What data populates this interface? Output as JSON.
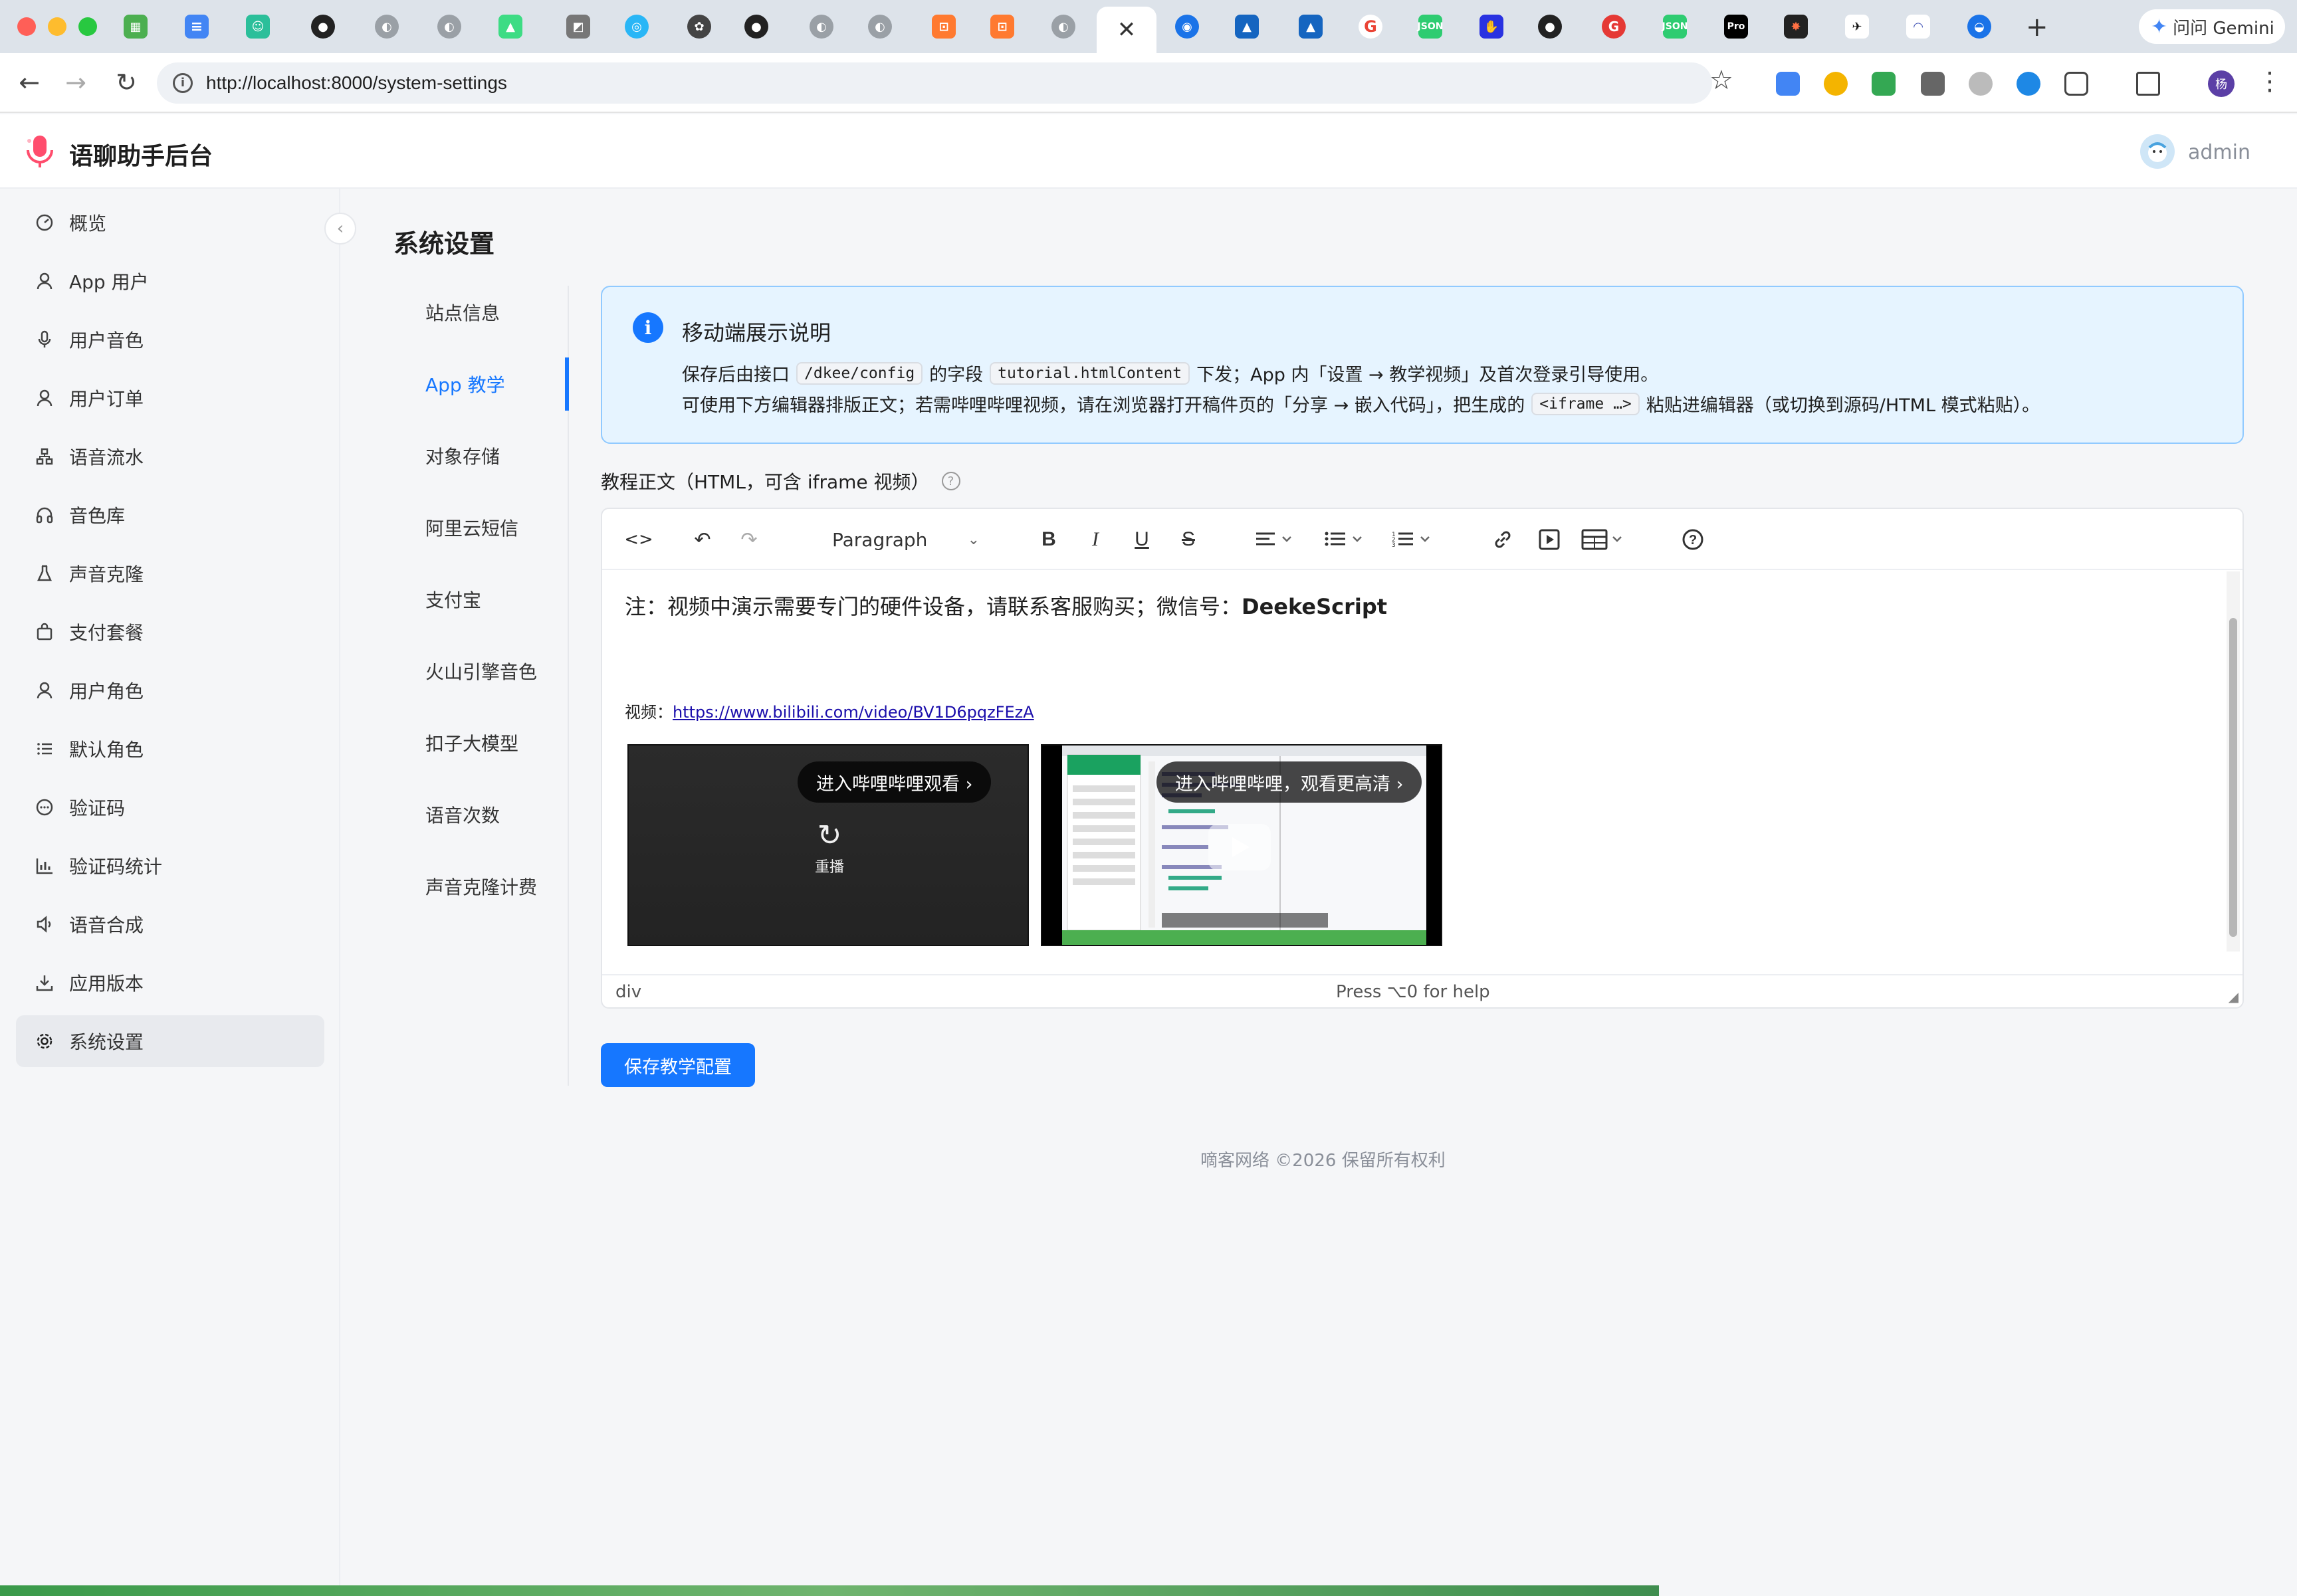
{
  "browser": {
    "active_tab_close": "✕",
    "new_tab": "+",
    "gemini_label": "问问 Gemini",
    "url": "http://localhost:8000/system-settings",
    "profile_initial": "杨"
  },
  "header": {
    "app_title": "语聊助手后台",
    "user_name": "admin"
  },
  "sidebar": {
    "collapse_glyph": "‹",
    "items": [
      {
        "label": "概览",
        "icon": "dashboard-icon"
      },
      {
        "label": "App 用户",
        "icon": "user-icon"
      },
      {
        "label": "用户音色",
        "icon": "microphone-icon"
      },
      {
        "label": "用户订单",
        "icon": "user-icon"
      },
      {
        "label": "语音流水",
        "icon": "cluster-icon"
      },
      {
        "label": "音色库",
        "icon": "headphones-icon"
      },
      {
        "label": "声音克隆",
        "icon": "flask-icon"
      },
      {
        "label": "支付套餐",
        "icon": "shopping-bag-icon"
      },
      {
        "label": "用户角色",
        "icon": "user-icon"
      },
      {
        "label": "默认角色",
        "icon": "list-icon"
      },
      {
        "label": "验证码",
        "icon": "message-dots-icon"
      },
      {
        "label": "验证码统计",
        "icon": "bar-chart-icon"
      },
      {
        "label": "语音合成",
        "icon": "sound-icon"
      },
      {
        "label": "应用版本",
        "icon": "download-icon"
      },
      {
        "label": "系统设置",
        "icon": "gear-icon",
        "active": true
      }
    ]
  },
  "main": {
    "page_title": "系统设置",
    "settings_tabs": [
      {
        "label": "站点信息"
      },
      {
        "label": "App 教学",
        "active": true
      },
      {
        "label": "对象存储"
      },
      {
        "label": "阿里云短信"
      },
      {
        "label": "支付宝"
      },
      {
        "label": "火山引擎音色"
      },
      {
        "label": "扣子大模型"
      },
      {
        "label": "语音次数"
      },
      {
        "label": "声音克隆计费"
      }
    ],
    "alert": {
      "title": "移动端展示说明",
      "line1_a": "保存后由接口",
      "line1_code1": "/dkee/config",
      "line1_b": "的字段",
      "line1_code2": "tutorial.htmlContent",
      "line1_c": "下发；App 内「设置 → 教学视频」及首次登录引导使用。",
      "line2_a": "可使用下方编辑器排版正文；若需哔哩哔哩视频，请在浏览器打开稿件页的「分享 → 嵌入代码」，把生成的",
      "line2_code": "<iframe …>",
      "line2_b": "粘贴进编辑器（或切换到源码/HTML 模式粘贴）。"
    },
    "editor_label": "教程正文（HTML，可含 iframe 视频）",
    "editor": {
      "block_format": "Paragraph",
      "note_prefix": "注：视频中演示需要专门的硬件设备，请联系客服购买；微信号：",
      "note_wechat": "DeekeScript",
      "video_prefix": "视频：",
      "video_link": "https://www.bilibili.com/video/BV1D6pqzFEzA",
      "iframe1_pill": "进入哔哩哔哩观看 ›",
      "iframe1_replay": "重播",
      "iframe2_pill": "进入哔哩哔哩，观看更高清 ›",
      "status_path": "div",
      "status_help": "Press ⌥0 for help"
    },
    "save_button": "保存教学配置",
    "footer": "嘀客网络 ©2026 保留所有权利"
  },
  "colors": {
    "primary": "#1677ff",
    "alert_bg": "#e6f4ff",
    "alert_border": "#91caff",
    "sidebar_active_bg": "#e8eaee"
  }
}
